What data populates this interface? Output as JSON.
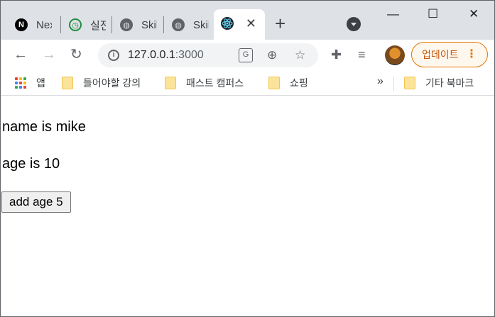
{
  "browser": {
    "tabs": [
      {
        "title": "Nex",
        "favicon": "nextjs-n-icon"
      },
      {
        "title": "실전",
        "favicon": "green-clock-icon"
      },
      {
        "title": "Skil",
        "favicon": "globe-icon"
      },
      {
        "title": "Skil",
        "favicon": "globe-icon"
      },
      {
        "title": "",
        "favicon": "react-icon",
        "active": true
      }
    ],
    "close_glyph": "✕",
    "new_tab_glyph": "+",
    "window_controls": {
      "minimize": "—",
      "maximize": "☐",
      "close": "✕"
    }
  },
  "toolbar": {
    "url_host": "127.0.0.1",
    "url_port": ":3000",
    "update_label": "업데이트",
    "update_menu_glyph": "⋮"
  },
  "bookmarks": {
    "apps_label": "앱",
    "items": [
      "들어야할 강의",
      "패스트 캠퍼스",
      "쇼핑"
    ],
    "overflow": "»",
    "other_label": "기타 북마크"
  },
  "page": {
    "name_text": "name is mike",
    "age_text": "age is 10",
    "button_label": "add age 5"
  },
  "colors": {
    "tabstrip": "#dee1e6",
    "update_accent": "#e37400",
    "react_blue": "#61dafb"
  }
}
